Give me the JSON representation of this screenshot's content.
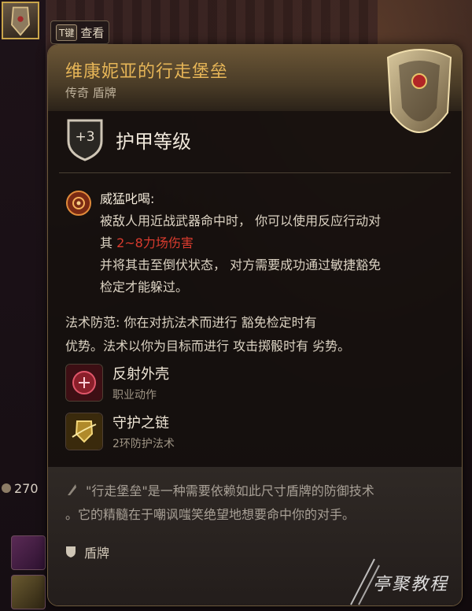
{
  "keyhint": {
    "key": "T键",
    "label": "查看"
  },
  "item": {
    "name": "维康妮亚的行走堡垒",
    "rarity_type": "传奇 盾牌",
    "armor_bonus": "+3",
    "armor_label": "护甲等级"
  },
  "feature": {
    "name": "威猛叱喝:",
    "line1": "被敌人用近战武器命中时， 你可以使用反应行动对",
    "line2_prefix": "其 ",
    "damage": "2~8力场伤害",
    "line3": "并将其击至倒伏状态， 对方需要成功通过敏捷豁免",
    "line4": "检定才能躲过。"
  },
  "spell_ward": {
    "line1": "法术防范: 你在对抗法术而进行 豁免检定时有",
    "line2": "优势。法术以你为目标而进行 攻击掷骰时有 劣势。"
  },
  "actions": [
    {
      "name": "反射外壳",
      "type": "职业动作"
    },
    {
      "name": "守护之链",
      "type": "2环防护法术"
    }
  ],
  "flavor": {
    "line1": "\"行走堡垒\"是一种需要依赖如此尺寸盾牌的防御技术",
    "line2": "。它的精髓在于嘲讽嗤笑绝望地想要命中你的对手。"
  },
  "item_type": "盾牌",
  "side": {
    "count": "270"
  },
  "watermark": {
    "brand": "亭聚教程"
  },
  "colors": {
    "title": "#e6b557",
    "damage": "#d93b2e",
    "gold_border": "#c9a54a"
  }
}
